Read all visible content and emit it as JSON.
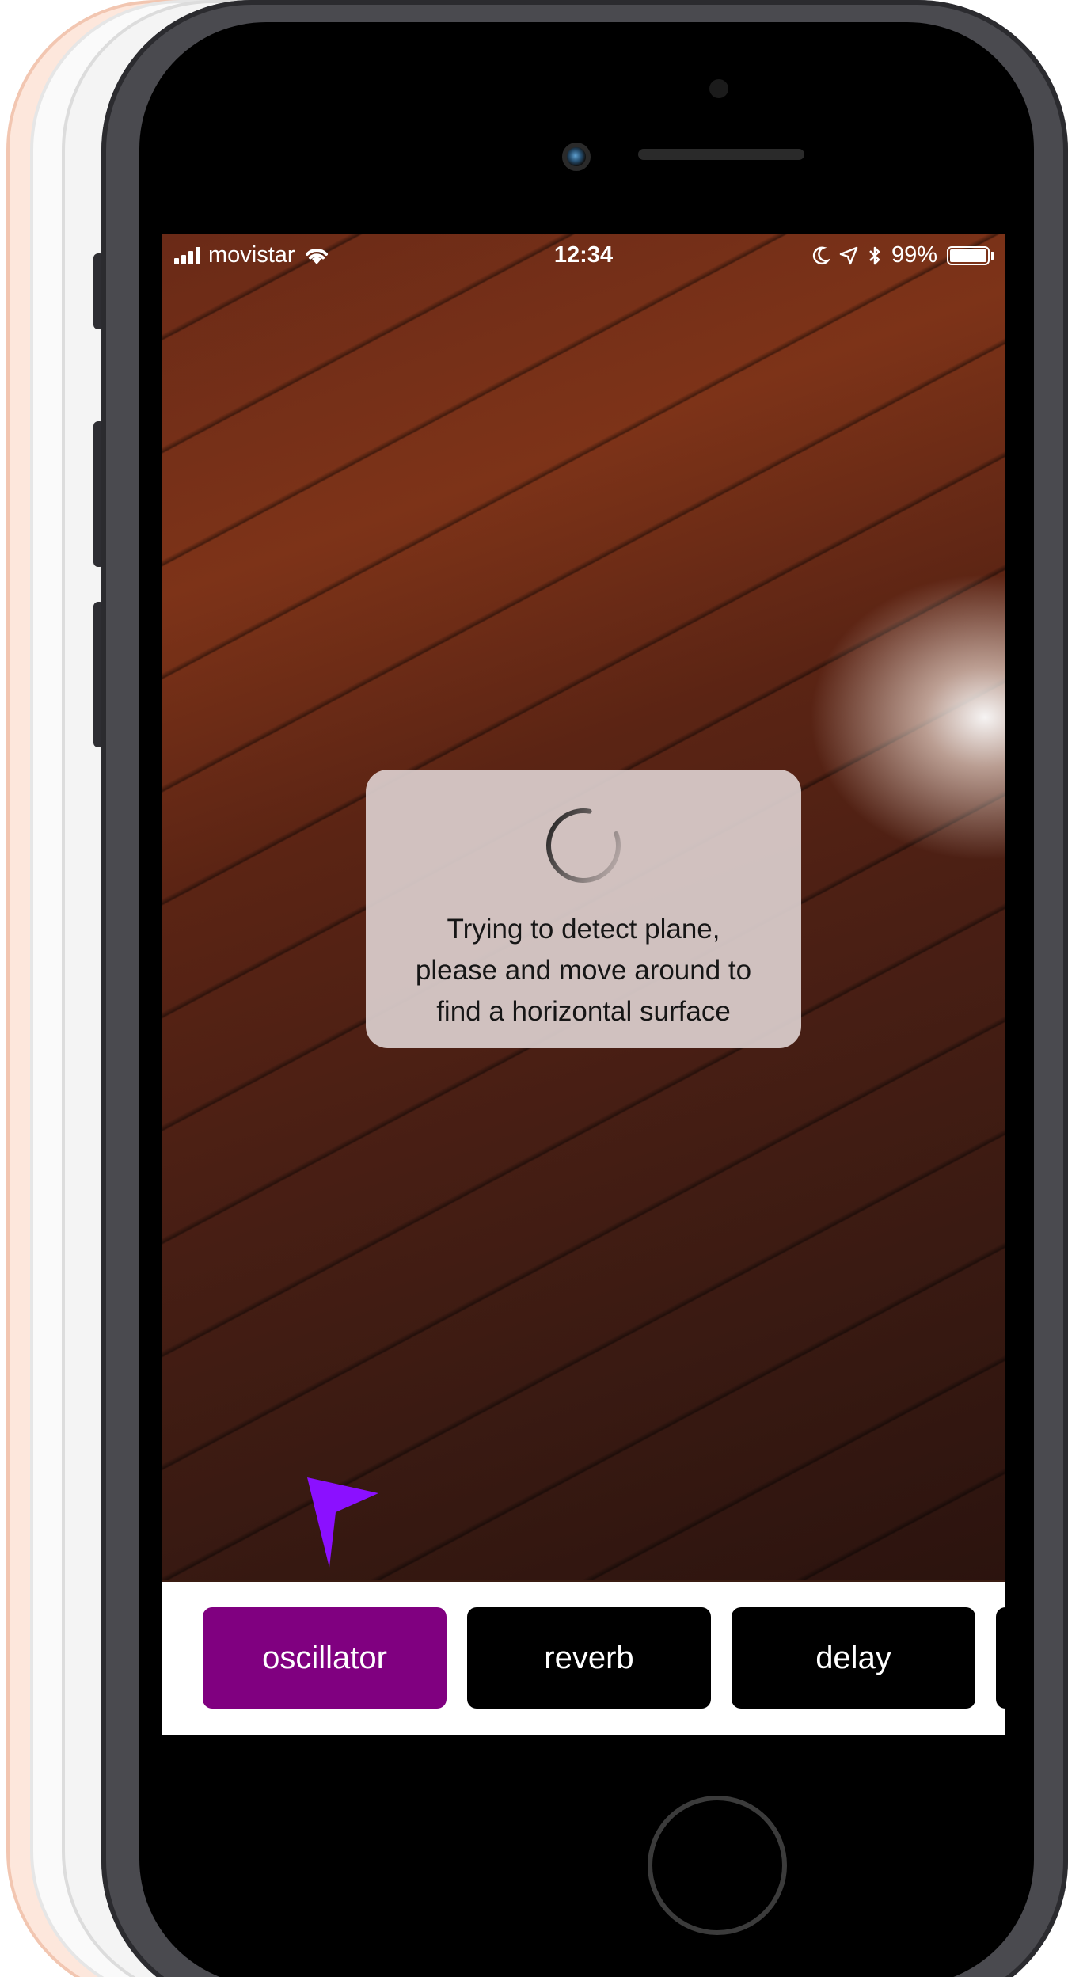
{
  "status_bar": {
    "carrier": "movistar",
    "time": "12:34",
    "battery_percent": "99%",
    "battery_level": 0.99,
    "icons": [
      "signal-bars-icon",
      "wifi-icon",
      "moon-icon",
      "location-arrow-icon",
      "bluetooth-icon",
      "battery-icon"
    ]
  },
  "dialog": {
    "message": "Trying to detect plane,\nplease and move around to\nfind a horizontal surface",
    "icon": "loading-spinner-icon"
  },
  "toolbar": {
    "buttons": [
      {
        "label": "oscillator",
        "selected": true
      },
      {
        "label": "reverb",
        "selected": false
      },
      {
        "label": "delay",
        "selected": false
      }
    ],
    "selected_color": "#800080",
    "default_color": "#000000"
  },
  "pointer": {
    "icon": "pointer-arrow-icon",
    "color": "#8b10ff"
  }
}
